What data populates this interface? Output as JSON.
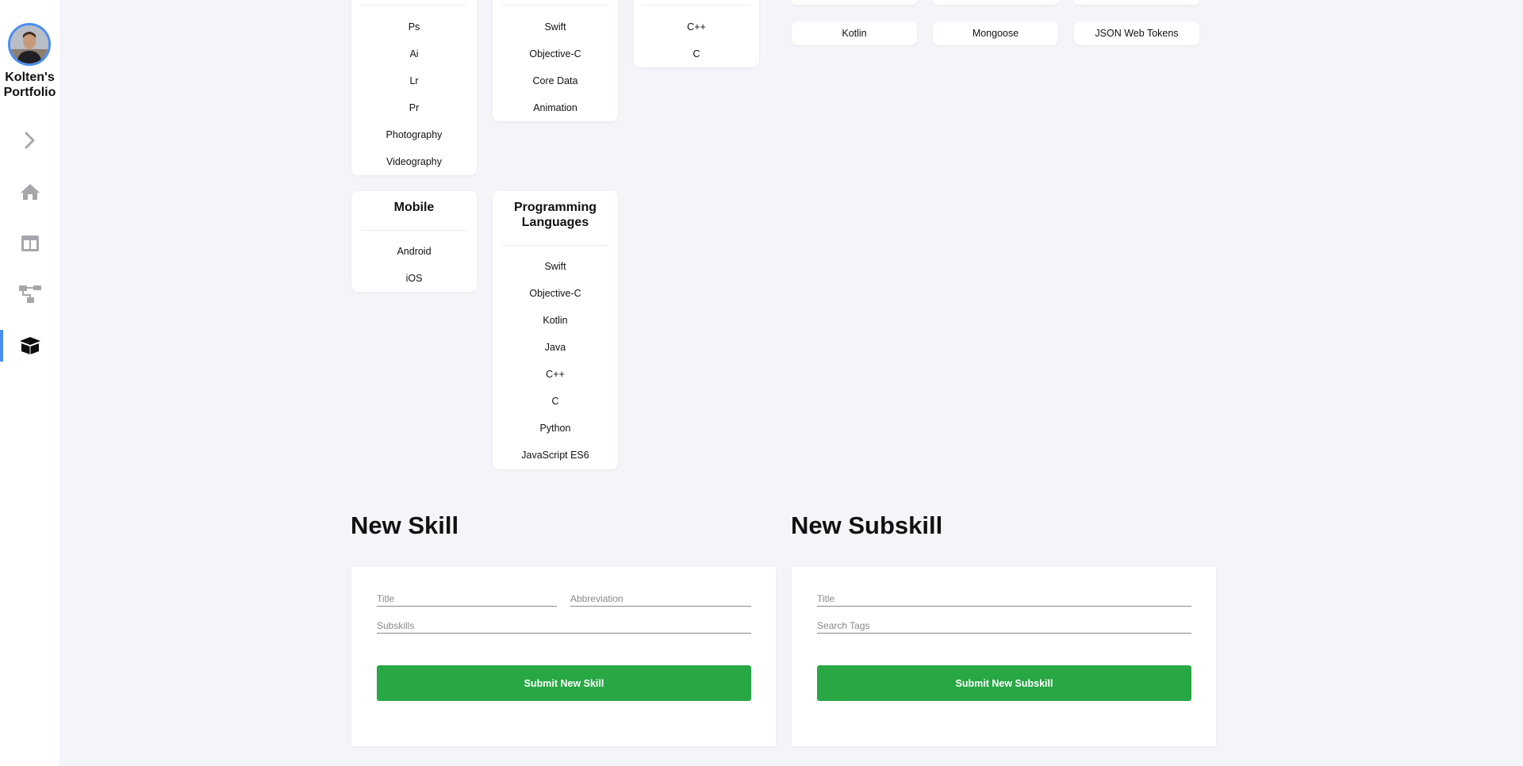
{
  "sidebar": {
    "brand_line1": "Kolten's",
    "brand_line2": "Portfolio",
    "nav": [
      {
        "icon": "chevron-right-icon"
      },
      {
        "icon": "home-icon"
      },
      {
        "icon": "layout-icon"
      },
      {
        "icon": "sitemap-icon"
      },
      {
        "icon": "open-box-icon",
        "active": true
      }
    ]
  },
  "cards": {
    "design": {
      "items": [
        "Ps",
        "Ai",
        "Lr",
        "Pr",
        "Photography",
        "Videography"
      ]
    },
    "ios": {
      "items": [
        "Swift",
        "Objective-C",
        "Core Data",
        "Animation"
      ]
    },
    "systems": {
      "items": [
        "C++",
        "C"
      ]
    },
    "mobile": {
      "title": "Mobile",
      "items": [
        "Android",
        "iOS"
      ]
    },
    "programming": {
      "title_line1": "Programming",
      "title_line2": "Languages",
      "items": [
        "Swift",
        "Objective-C",
        "Kotlin",
        "Java",
        "C++",
        "C",
        "Python",
        "JavaScript ES6"
      ]
    }
  },
  "subskill_pills": [
    "Kotlin",
    "Mongoose",
    "JSON Web Tokens"
  ],
  "new_skill": {
    "heading": "New Skill",
    "title_placeholder": "Title",
    "abbreviation_placeholder": "Abbreviation",
    "subskills_placeholder": "Subskills",
    "submit_label": "Submit New Skill"
  },
  "new_subskill": {
    "heading": "New Subskill",
    "title_placeholder": "Title",
    "tags_placeholder": "Search Tags",
    "submit_label": "Submit New Subskill"
  },
  "colors": {
    "accent": "#4a8cf0",
    "submit": "#28a745",
    "background": "#f4f5f9"
  }
}
